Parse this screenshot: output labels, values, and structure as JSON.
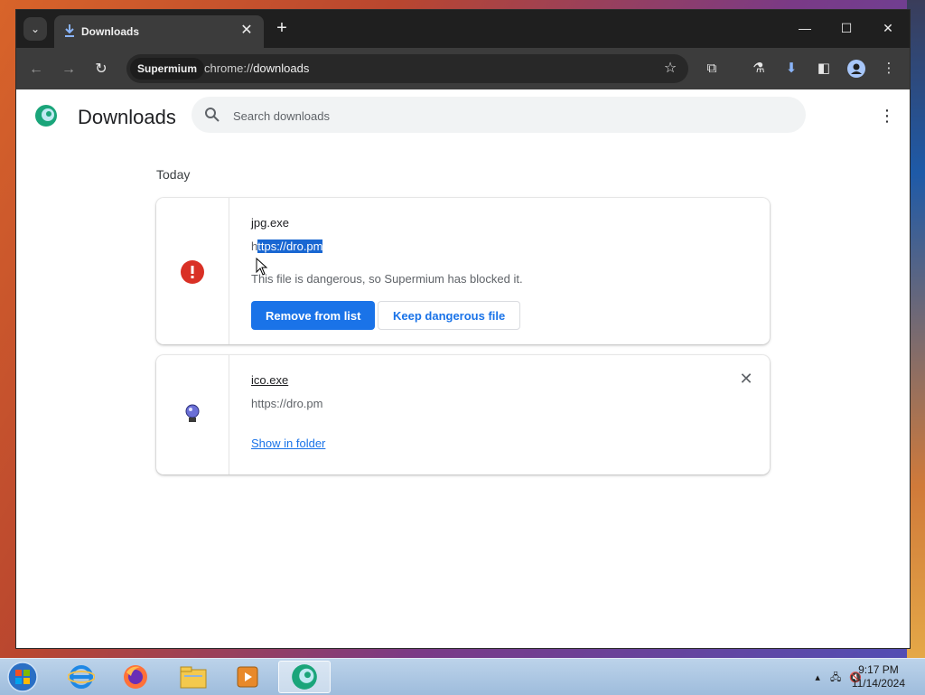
{
  "browser": {
    "tab_title": "Downloads",
    "new_tab_label": "+",
    "window_controls": {
      "minimize": "—",
      "maximize": "☐",
      "close": "✕"
    },
    "omnibox": {
      "chip_label": "Supermium",
      "url_scheme": "chrome://",
      "url_host": "downloads"
    }
  },
  "page": {
    "title": "Downloads",
    "search_placeholder": "Search downloads",
    "section_label": "Today"
  },
  "downloads": [
    {
      "filename": "jpg.exe",
      "url_prefix": "h",
      "url_selected": "ttps://dro.pm",
      "message": "This file is dangerous, so Supermium has blocked it.",
      "primary_action": "Remove from list",
      "secondary_action": "Keep dangerous file",
      "status": "dangerous",
      "status_color": "#d93025"
    },
    {
      "filename": "ico.exe",
      "url": "https://dro.pm",
      "action_link": "Show in folder"
    }
  ],
  "taskbar": {
    "items": [
      "start-orb",
      "internet-explorer",
      "firefox",
      "file-explorer",
      "media-player",
      "supermium"
    ],
    "clock_time": "9:17 PM",
    "clock_date": "11/14/2024"
  },
  "colors": {
    "accent": "#1a73e8",
    "titlebar": "#1f1f1f",
    "toolbar": "#3c3c3c"
  }
}
